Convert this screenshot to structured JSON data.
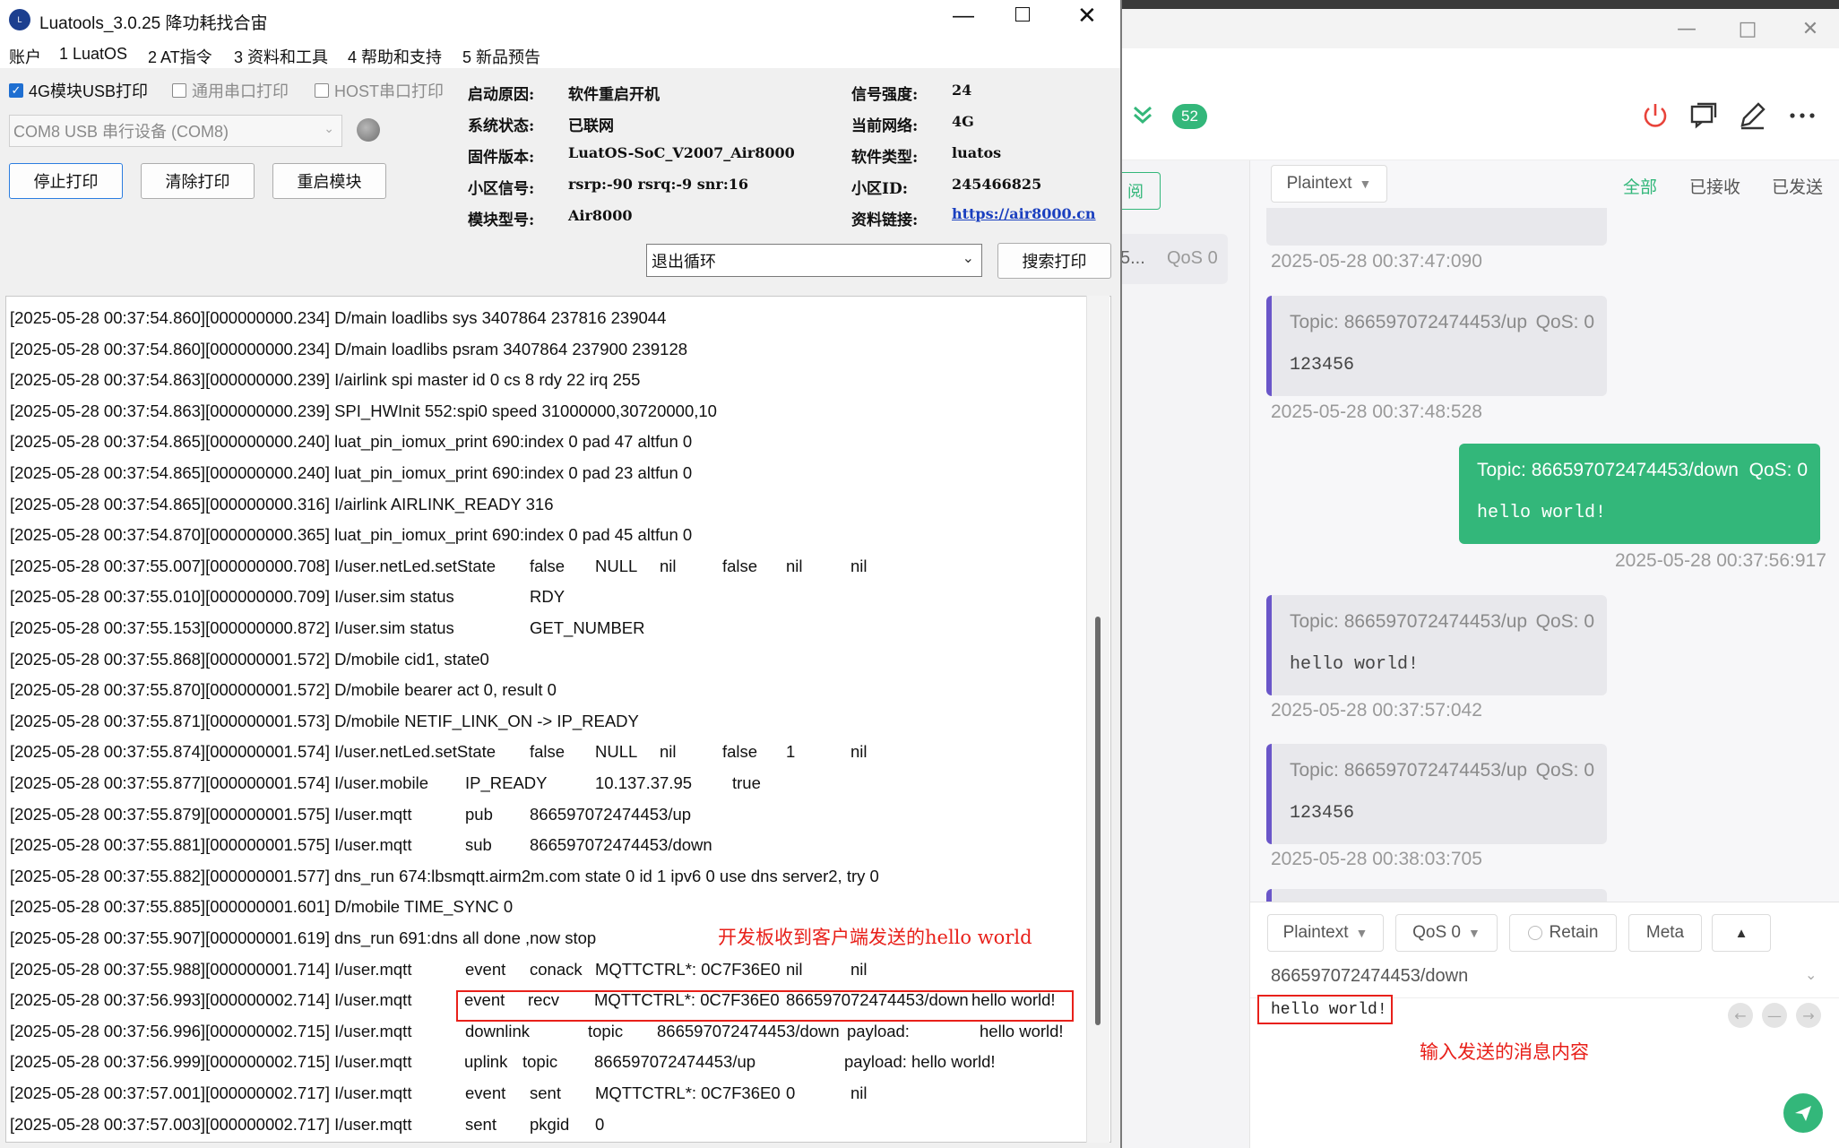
{
  "colors": {
    "accent_green": "#33b77a",
    "accent_purple": "#6a56c9",
    "annotation_red": "#e8201a",
    "link_blue": "#1a3fbf",
    "disconnect_red": "#e8433a"
  },
  "luatools": {
    "title": "Luatools_3.0.25 降功耗找合宙",
    "menu": [
      "账户",
      "1 LuatOS",
      "2 AT指令",
      "3 资料和工具",
      "4 帮助和支持",
      "5 新品预告"
    ],
    "checkboxes": [
      {
        "label": "4G模块USB打印",
        "checked": true
      },
      {
        "label": "通用串口打印",
        "checked": false
      },
      {
        "label": "HOST串口打印",
        "checked": false
      }
    ],
    "port_select": "COM8 USB 串行设备 (COM8)",
    "buttons": {
      "stop": "停止打印",
      "clear": "清除打印",
      "restart": "重启模块",
      "search": "搜索打印"
    },
    "loop_select": "退出循环",
    "info": {
      "boot_reason_label": "启动原因:",
      "boot_reason": "软件重启开机",
      "sys_status_label": "系统状态:",
      "sys_status": "已联网",
      "firmware_label": "固件版本:",
      "firmware": "LuatOS-SoC_V2007_Air8000",
      "cell_signal_label": "小区信号:",
      "cell_signal": "rsrp:-90 rsrq:-9 snr:16",
      "module_label": "模块型号:",
      "module": "Air8000",
      "signal_label": "信号强度:",
      "signal": "24",
      "network_label": "当前网络:",
      "network": "4G",
      "software_label": "软件类型:",
      "software": "luatos",
      "cell_id_label": "小区ID:",
      "cell_id": "245466825",
      "link_label": "资料链接:",
      "link": "https://air8000.cn"
    },
    "log": [
      [
        "[2025-05-28 00:37:54.860][000000000.234] D/main loadlibs sys   3407864 237816 239044"
      ],
      [
        "[2025-05-28 00:37:54.860][000000000.234] D/main loadlibs psram 3407864 237900 239128"
      ],
      [
        "[2025-05-28 00:37:54.863][000000000.239] I/airlink spi master id 0 cs 8 rdy 22 irq 255"
      ],
      [
        "[2025-05-28 00:37:54.863][000000000.239] SPI_HWInit 552:spi0 speed 31000000,30720000,10"
      ],
      [
        "[2025-05-28 00:37:54.865][000000000.240] luat_pin_iomux_print 690:index 0 pad 47 altfun 0"
      ],
      [
        "[2025-05-28 00:37:54.865][000000000.240] luat_pin_iomux_print 690:index 0 pad 23 altfun 0"
      ],
      [
        "[2025-05-28 00:37:54.865][000000000.316] I/airlink AIRLINK_READY 316"
      ],
      [
        "[2025-05-28 00:37:54.870][000000000.365] luat_pin_iomux_print 690:index 0 pad 45 altfun 0"
      ],
      [
        "[2025-05-28 00:37:55.007][000000000.708] I/user.netLed.setState",
        "false",
        "NULL",
        "nil",
        "false",
        "nil",
        "nil"
      ],
      [
        "[2025-05-28 00:37:55.010][000000000.709] I/user.sim status",
        "RDY"
      ],
      [
        "[2025-05-28 00:37:55.153][000000000.872] I/user.sim status",
        "GET_NUMBER"
      ],
      [
        "[2025-05-28 00:37:55.868][000000001.572] D/mobile cid1, state0"
      ],
      [
        "[2025-05-28 00:37:55.870][000000001.572] D/mobile bearer act 0, result 0"
      ],
      [
        "[2025-05-28 00:37:55.871][000000001.573] D/mobile NETIF_LINK_ON -> IP_READY"
      ],
      [
        "[2025-05-28 00:37:55.874][000000001.574] I/user.netLed.setState",
        "false",
        "NULL",
        "nil",
        "false",
        "1",
        "nil"
      ],
      [
        "[2025-05-28 00:37:55.877][000000001.574] I/user.mobile",
        "IP_READY",
        "10.137.37.95",
        "true"
      ],
      [
        "[2025-05-28 00:37:55.879][000000001.575] I/user.mqtt",
        "pub",
        "866597072474453/up"
      ],
      [
        "[2025-05-28 00:37:55.881][000000001.575] I/user.mqtt",
        "sub",
        "866597072474453/down"
      ],
      [
        "[2025-05-28 00:37:55.882][000000001.577] dns_run 674:lbsmqtt.airm2m.com state 0 id 1 ipv6 0 use dns server2, try 0"
      ],
      [
        "[2025-05-28 00:37:55.885][000000001.601] D/mobile TIME_SYNC 0"
      ],
      [
        "[2025-05-28 00:37:55.907][000000001.619] dns_run 691:dns all done ,now stop"
      ],
      [
        "[2025-05-28 00:37:55.988][000000001.714] I/user.mqtt",
        "event",
        "conack",
        "MQTTCTRL*: 0C7F36E0",
        "nil",
        "nil"
      ],
      [
        "[2025-05-28 00:37:56.993][000000002.714] I/user.mqtt",
        "event",
        "recv",
        "MQTTCTRL*: 0C7F36E0",
        "866597072474453/down",
        "hello world!"
      ],
      [
        "[2025-05-28 00:37:56.996][000000002.715] I/user.mqtt",
        "downlink",
        "topic",
        "866597072474453/down",
        "payload:",
        "hello world!"
      ],
      [
        "[2025-05-28 00:37:56.999][000000002.715] I/user.mqtt",
        "uplink",
        "topic",
        "866597072474453/up",
        "payload:",
        "hello world!"
      ],
      [
        "[2025-05-28 00:37:57.001][000000002.717] I/user.mqtt",
        "event",
        "sent",
        "MQTTCTRL*: 0C7F36E0",
        "0",
        "nil"
      ],
      [
        "[2025-05-28 00:37:57.003][000000002.717] I/user.mqtt",
        "sent",
        "pkgid",
        "0"
      ]
    ],
    "annotation": "开发板收到客户端发送的hello world"
  },
  "mqttx": {
    "badge": "52",
    "left_partial": {
      "subscribe": "阅",
      "topic": "5...",
      "qos": "QoS 0"
    },
    "format": "Plaintext",
    "filters": [
      "全部",
      "已接收",
      "已发送"
    ],
    "partial_top_time": "2025-05-28 00:37:47:090",
    "messages": [
      {
        "dir": "in",
        "topic": "Topic: 866597072474453/up",
        "qos": "QoS: 0",
        "payload": "123456",
        "time": "2025-05-28 00:37:48:528"
      },
      {
        "dir": "out",
        "topic": "Topic: 866597072474453/down",
        "qos": "QoS: 0",
        "payload": "hello world!",
        "time": "2025-05-28 00:37:56:917"
      },
      {
        "dir": "in",
        "topic": "Topic: 866597072474453/up",
        "qos": "QoS: 0",
        "payload": "hello world!",
        "time": "2025-05-28 00:37:57:042"
      },
      {
        "dir": "in",
        "topic": "Topic: 866597072474453/up",
        "qos": "QoS: 0",
        "payload": "123456",
        "time": "2025-05-28 00:38:03:705"
      }
    ],
    "compose": {
      "format": "Plaintext",
      "qos": "QoS 0",
      "retain": "Retain",
      "meta": "Meta",
      "topic": "866597072474453/down",
      "payload": "hello world!"
    },
    "annotation": "输入发送的消息内容"
  }
}
